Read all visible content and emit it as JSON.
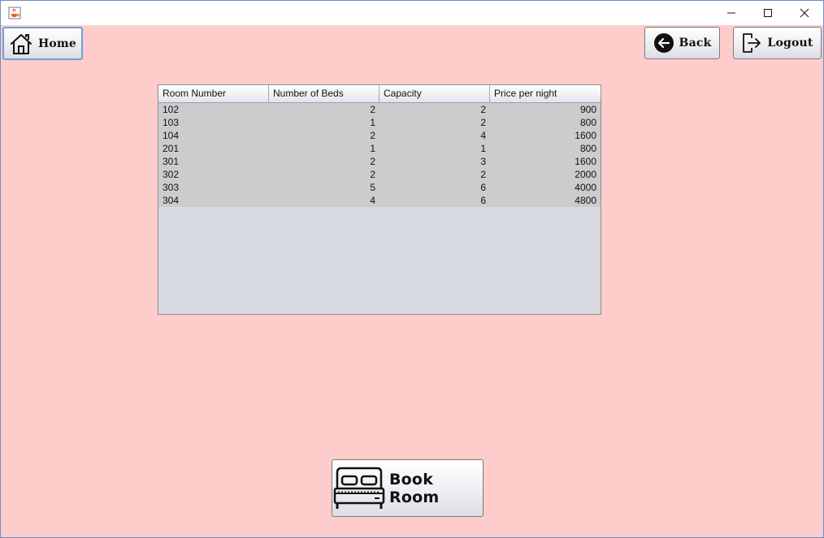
{
  "window": {
    "app_icon": "java-cup-icon"
  },
  "toolbar": {
    "home_label": "Home",
    "back_label": "Back",
    "logout_label": "Logout"
  },
  "table": {
    "columns": [
      "Room Number",
      "Number of Beds",
      "Capacity",
      "Price per night"
    ],
    "rows": [
      [
        "102",
        "2",
        "2",
        "900"
      ],
      [
        "103",
        "1",
        "2",
        "800"
      ],
      [
        "104",
        "2",
        "4",
        "1600"
      ],
      [
        "201",
        "1",
        "1",
        "800"
      ],
      [
        "301",
        "2",
        "3",
        "1600"
      ],
      [
        "302",
        "2",
        "2",
        "2000"
      ],
      [
        "303",
        "5",
        "6",
        "4000"
      ],
      [
        "304",
        "4",
        "6",
        "4800"
      ]
    ]
  },
  "actions": {
    "book_label": "Book Room"
  },
  "colors": {
    "background": "#ffcccc",
    "table_rows": "#cccccc",
    "table_empty": "#d6d9e0"
  }
}
